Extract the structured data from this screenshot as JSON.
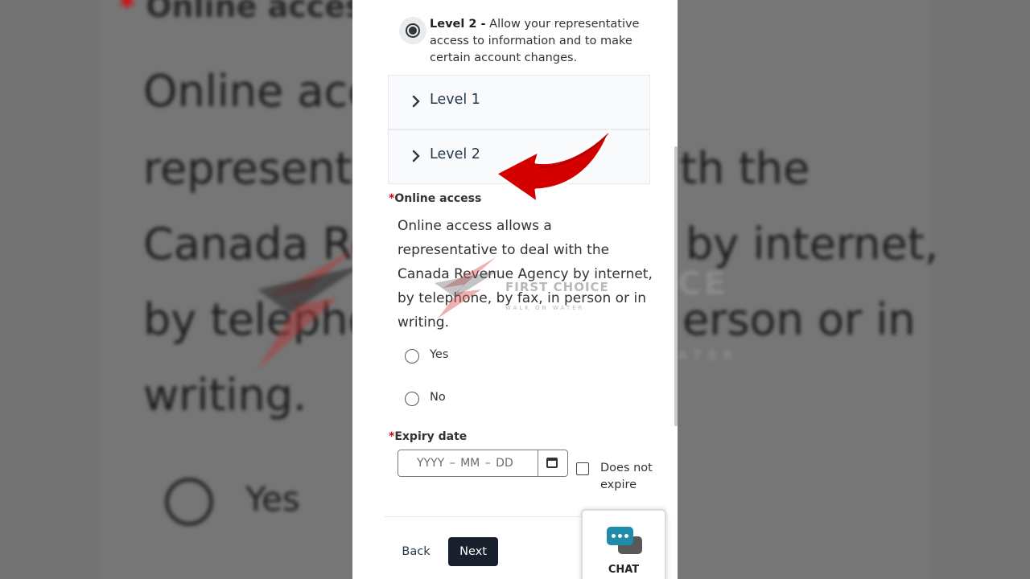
{
  "background": {
    "title": "Online access",
    "lines": [
      "Online acc",
      "representat",
      "th the",
      "Canada Re",
      "by internet,",
      "by telepho",
      "erson or in",
      "writing."
    ],
    "yes": "Yes",
    "logo": "CE",
    "logo_sub": "ATER"
  },
  "option_level2": {
    "bold": "Level 2 -",
    "text": " Allow your representative access to information and to make certain account changes."
  },
  "accordion": [
    {
      "label": "Level 1"
    },
    {
      "label": "Level 2"
    }
  ],
  "online_access": {
    "required_mark": "*",
    "label": "Online access",
    "description": "Online access allows a representative to deal with the Canada Revenue Agency by internet, by telephone, by fax, in person or in writing.",
    "options": [
      {
        "label": "Yes"
      },
      {
        "label": "No"
      }
    ]
  },
  "expiry": {
    "required_mark": "*",
    "label": "Expiry date",
    "placeholder": "YYYY  – MM –  DD",
    "checkbox_label": "Does not expire"
  },
  "buttons": {
    "back": "Back",
    "next": "Next"
  },
  "chat": {
    "label": "CHAT"
  },
  "watermark": {
    "title": "FIRST CHOICE",
    "subtitle": "WALK ON WATER"
  },
  "colors": {
    "arrow": "#d40000",
    "required": "#d3080c",
    "link": "#26374a",
    "primary_button": "#17202c"
  }
}
